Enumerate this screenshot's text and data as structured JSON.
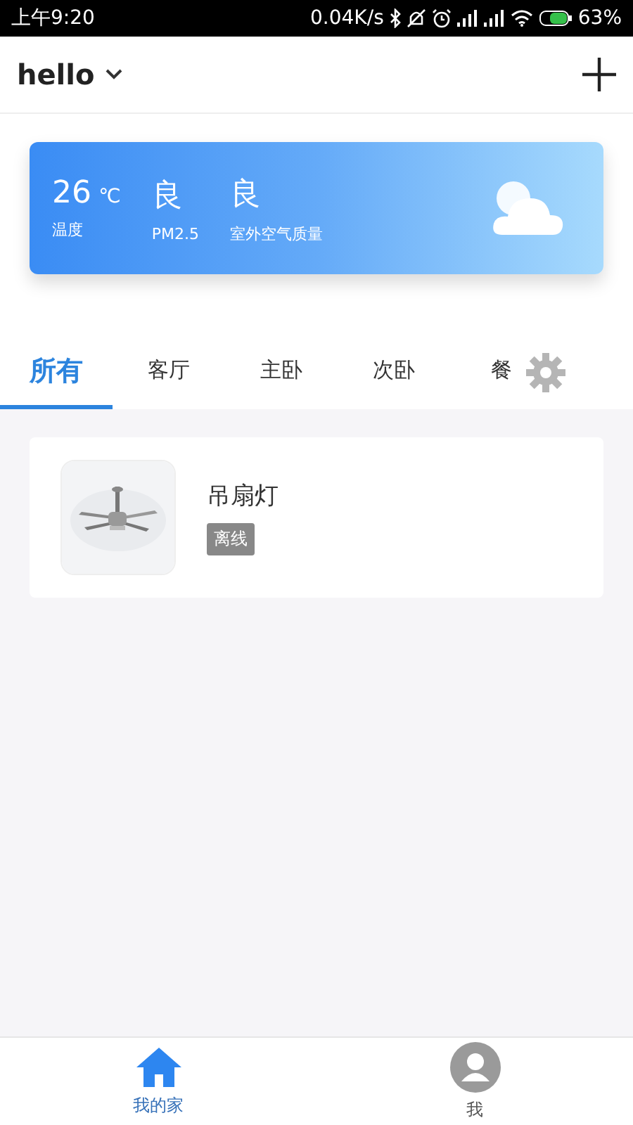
{
  "status_bar": {
    "time": "上午9:20",
    "speed": "0.04K/s",
    "battery": "63%"
  },
  "header": {
    "title": "hello"
  },
  "weather": {
    "temperature": "26",
    "unit": "℃",
    "temperature_label": "温度",
    "pm25": "良",
    "pm25_label": "PM2.5",
    "air": "良",
    "air_label": "室外空气质量"
  },
  "tabs": [
    {
      "label": "所有",
      "selected": true
    },
    {
      "label": "客厅",
      "selected": false
    },
    {
      "label": "主卧",
      "selected": false
    },
    {
      "label": "次卧",
      "selected": false
    },
    {
      "label": "餐",
      "selected": false
    }
  ],
  "devices": [
    {
      "name": "吊扇灯",
      "status": "离线"
    }
  ],
  "bottom_nav": [
    {
      "label": "我的家",
      "kind": "home",
      "selected": true
    },
    {
      "label": "我",
      "kind": "profile",
      "selected": false
    }
  ]
}
